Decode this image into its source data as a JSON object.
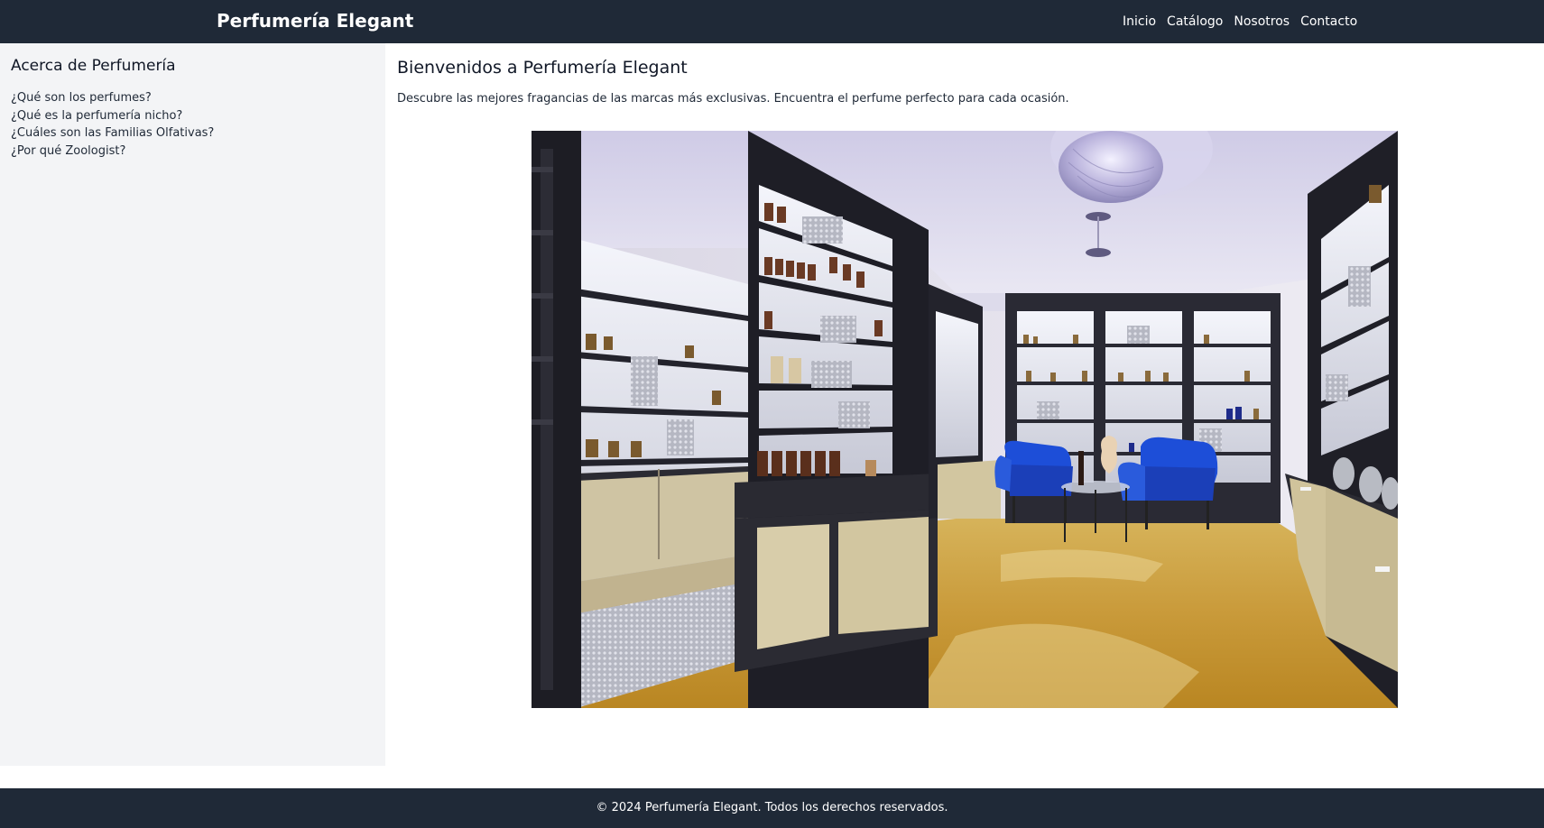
{
  "header": {
    "brand": "Perfumería Elegant",
    "nav": [
      {
        "label": "Inicio"
      },
      {
        "label": "Catálogo"
      },
      {
        "label": "Nosotros"
      },
      {
        "label": "Contacto"
      }
    ]
  },
  "sidebar": {
    "title": "Acerca de Perfumería",
    "links": [
      {
        "label": "¿Qué son los perfumes?"
      },
      {
        "label": "¿Qué es la perfumería nicho?"
      },
      {
        "label": "¿Cuáles son las Familias Olfativas?"
      },
      {
        "label": "¿Por qué Zoologist?"
      }
    ]
  },
  "main": {
    "title": "Bienvenidos a Perfumería Elegant",
    "description": "Descubre las mejores fragancias de las marcas más exclusivas. Encuentra el perfume perfecto para cada ocasión."
  },
  "footer": {
    "text": "© 2024 Perfumería Elegant. Todos los derechos reservados."
  },
  "colors": {
    "header_bg": "#1f2937",
    "sidebar_bg": "#f3f4f6",
    "footer_bg": "#1f2937",
    "chair_blue": "#1d4ed8",
    "floor_gold": "#c99a3a"
  }
}
